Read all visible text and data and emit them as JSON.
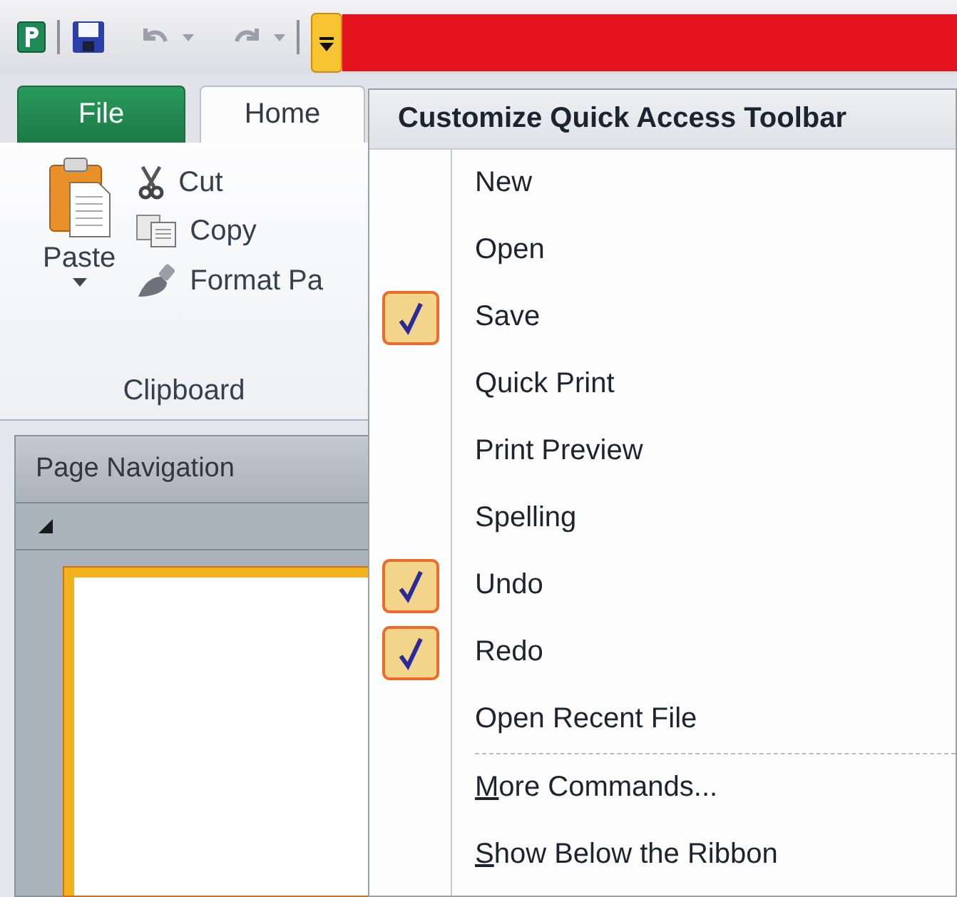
{
  "tabs": [
    {
      "label": "File",
      "kind": "backstage",
      "selected": false
    },
    {
      "label": "Home",
      "kind": "ribbon",
      "selected": true
    }
  ],
  "clipboard": {
    "paste": "Paste",
    "commands": [
      {
        "label": "Cut",
        "kind": "cut"
      },
      {
        "label": "Copy",
        "kind": "copy"
      },
      {
        "label": "Format Pa",
        "kind": "format"
      }
    ],
    "group_label": "Clipboard"
  },
  "navigation_pane": {
    "title": "Page Navigation"
  },
  "menu": {
    "title": "Customize Quick Access Toolbar",
    "items": [
      {
        "label": "New",
        "checked": false
      },
      {
        "label": "Open",
        "checked": false
      },
      {
        "label": "Save",
        "checked": true
      },
      {
        "label": "Quick Print",
        "checked": false
      },
      {
        "label": "Print Preview",
        "checked": false
      },
      {
        "label": "Spelling",
        "checked": false
      },
      {
        "label": "Undo",
        "checked": true
      },
      {
        "label": "Redo",
        "checked": true
      },
      {
        "label": "Open Recent File",
        "checked": false
      }
    ],
    "footer_items": [
      {
        "label": "More Commands...",
        "underline_first": true
      },
      {
        "label": "Show Below the Ribbon",
        "underline_first": true
      }
    ]
  }
}
